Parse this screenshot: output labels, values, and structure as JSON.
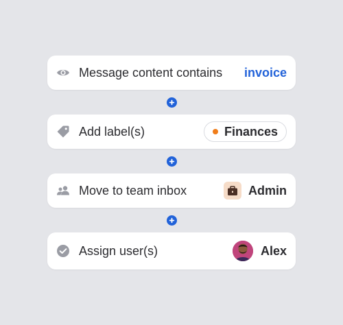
{
  "colors": {
    "accent": "#2162d9",
    "label_dot": "#f07d1a",
    "icon_gray": "#9a9ca4"
  },
  "steps": [
    {
      "label": "Message content contains",
      "value": "invoice",
      "icon": "eye-icon"
    },
    {
      "label": "Add label(s)",
      "value": "Finances",
      "icon": "tag-icon"
    },
    {
      "label": "Move to team inbox",
      "value": "Admin",
      "icon": "team-icon"
    },
    {
      "label": "Assign user(s)",
      "value": "Alex",
      "icon": "check-circle-icon"
    }
  ],
  "connectors": [
    "plus-icon",
    "plus-icon",
    "plus-icon"
  ]
}
